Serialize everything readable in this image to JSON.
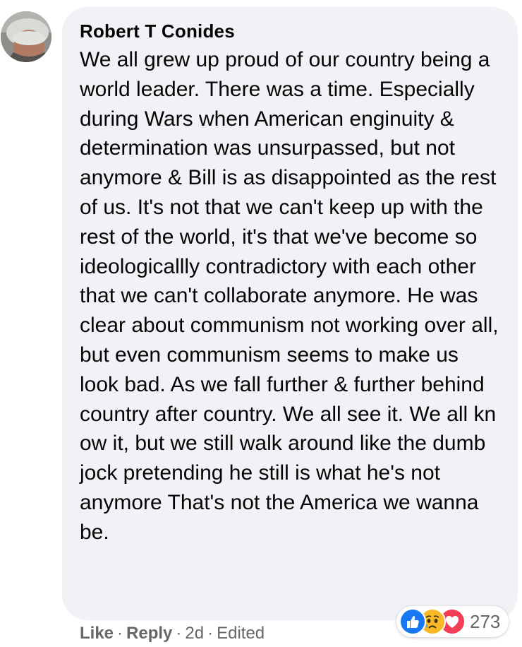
{
  "comment": {
    "author": "Robert T Conides",
    "text": "We all grew up proud of our country being a world leader. There was a time. Especially during Wars when American enginuity & determination was unsurpassed, but not anymore & Bill is as disappointed as the rest of us. It's not that we can't keep up with the rest of the world, it's that we've become so ideologicallly contradictory with each other that we can't collaborate anymore. He was clear about communism not working over all, but even communism seems to make us look bad. As we fall further & further behind country after country. We all see it. We all kn ow it, but we still walk around like the dumb jock pretending he still is what he's not anymore That's not the America we wanna be."
  },
  "actions": {
    "like": "Like",
    "reply": "Reply",
    "separator": "·",
    "time": "2d",
    "edited": "Edited"
  },
  "reactions": {
    "icons": [
      "like-icon",
      "sad-icon",
      "love-icon"
    ],
    "count": "273",
    "colors": {
      "like": "#1877f2",
      "sad": "#f7b928",
      "love": "#f33e58"
    }
  },
  "colors": {
    "bubble": "#f0f2f5",
    "text": "#050505",
    "secondary": "#65676b"
  }
}
